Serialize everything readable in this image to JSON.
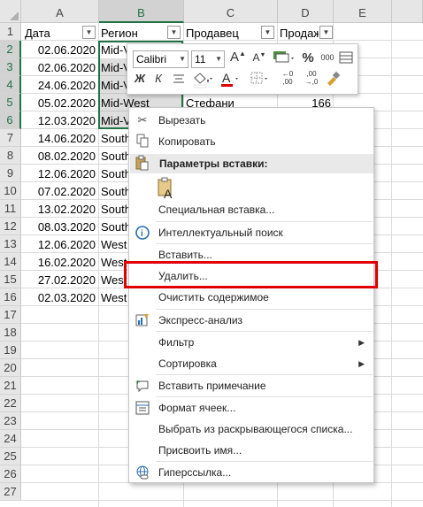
{
  "columns": [
    "A",
    "B",
    "C",
    "D",
    "E"
  ],
  "headers": {
    "date": "Дата",
    "region": "Регион",
    "seller": "Продавец",
    "sales": "Продаж"
  },
  "rows": [
    {
      "num": "1"
    },
    {
      "num": "2",
      "date": "02.06.2020",
      "region": "Mid-V"
    },
    {
      "num": "3",
      "date": "02.06.2020",
      "region": "Mid-V"
    },
    {
      "num": "4",
      "date": "24.06.2020",
      "region": "Mid-V"
    },
    {
      "num": "5",
      "date": "05.02.2020",
      "region": "Mid-West",
      "seller": "Стефани",
      "sales": "166"
    },
    {
      "num": "6",
      "date": "12.03.2020",
      "region": "Mid-V"
    },
    {
      "num": "7",
      "date": "14.06.2020",
      "region": "South"
    },
    {
      "num": "8",
      "date": "08.02.2020",
      "region": "South"
    },
    {
      "num": "9",
      "date": "12.06.2020",
      "region": "South"
    },
    {
      "num": "10",
      "date": "07.02.2020",
      "region": "South"
    },
    {
      "num": "11",
      "date": "13.02.2020",
      "region": "South"
    },
    {
      "num": "12",
      "date": "08.03.2020",
      "region": "South"
    },
    {
      "num": "13",
      "date": "12.06.2020",
      "region": "West"
    },
    {
      "num": "14",
      "date": "16.02.2020",
      "region": "West"
    },
    {
      "num": "15",
      "date": "27.02.2020",
      "region": "West"
    },
    {
      "num": "16",
      "date": "02.03.2020",
      "region": "West"
    },
    {
      "num": "17"
    },
    {
      "num": "18"
    },
    {
      "num": "19"
    },
    {
      "num": "20"
    },
    {
      "num": "21"
    },
    {
      "num": "22"
    },
    {
      "num": "23"
    },
    {
      "num": "24"
    },
    {
      "num": "25"
    },
    {
      "num": "26"
    },
    {
      "num": "27"
    }
  ],
  "toolbar": {
    "font": "Calibri",
    "size": "11",
    "percent": "%",
    "thousands": "000"
  },
  "menu": {
    "cut": "Вырезать",
    "copy": "Копировать",
    "paste_options": "Параметры вставки:",
    "paste_special": "Специальная вставка...",
    "smart_lookup": "Интеллектуальный поиск",
    "insert": "Вставить...",
    "delete": "Удалить...",
    "clear": "Очистить содержимое",
    "quick_analysis": "Экспресс-анализ",
    "filter": "Фильтр",
    "sort": "Сортировка",
    "insert_comment": "Вставить примечание",
    "format_cells": "Формат ячеек...",
    "pick_from_list": "Выбрать из раскрывающегося списка...",
    "define_name": "Присвоить имя...",
    "hyperlink": "Гиперссылка..."
  },
  "colors": {
    "accent": "#217346",
    "highlight": "#e00000",
    "font_color_bar": "#e00000"
  }
}
